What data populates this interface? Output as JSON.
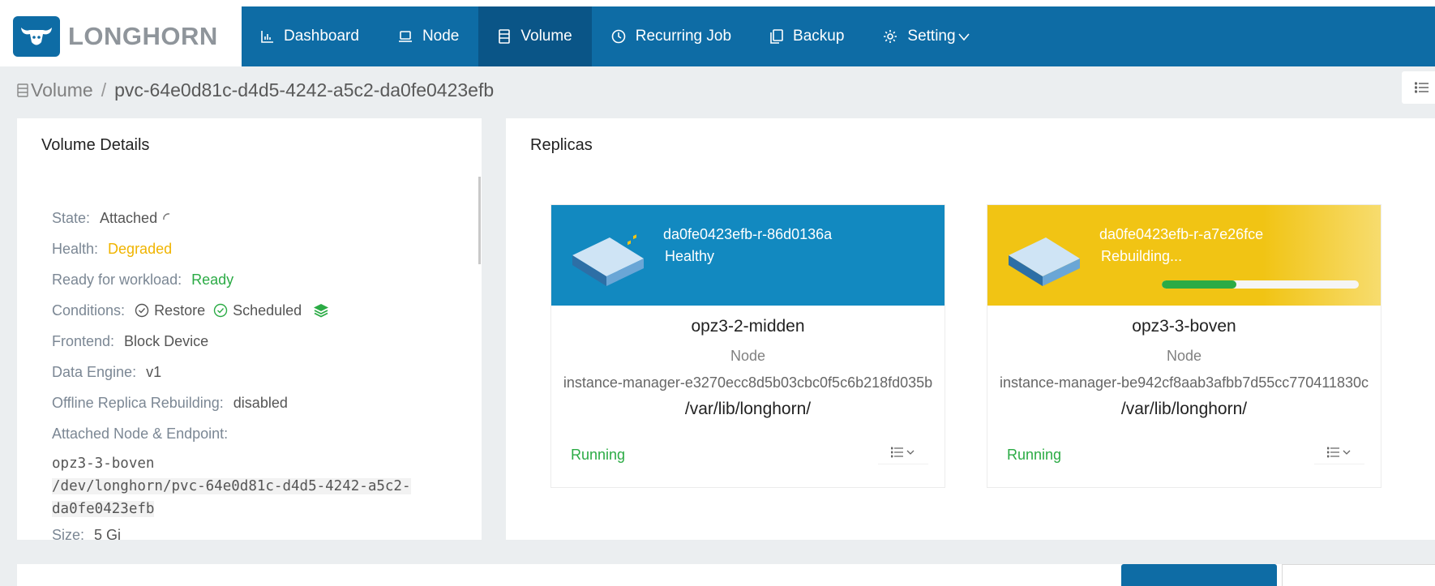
{
  "brand": {
    "name": "LONGHORN"
  },
  "nav": {
    "items": [
      {
        "label": "Dashboard",
        "icon": "bar-chart-icon"
      },
      {
        "label": "Node",
        "icon": "laptop-icon"
      },
      {
        "label": "Volume",
        "icon": "database-icon",
        "active": true
      },
      {
        "label": "Recurring Job",
        "icon": "clock-icon"
      },
      {
        "label": "Backup",
        "icon": "copy-icon"
      },
      {
        "label": "Setting",
        "icon": "gear-icon"
      }
    ]
  },
  "breadcrumb": {
    "parent": "Volume",
    "separator": "/",
    "current": "pvc-64e0d81c-d4d5-4242-a5c2-da0fe0423efb"
  },
  "details": {
    "title": "Volume Details",
    "state_label": "State:",
    "state_value": "Attached",
    "health_label": "Health:",
    "health_value": "Degraded",
    "ready_label": "Ready for workload:",
    "ready_value": "Ready",
    "conditions_label": "Conditions:",
    "condition_restore": "Restore",
    "condition_scheduled": "Scheduled",
    "frontend_label": "Frontend:",
    "frontend_value": "Block Device",
    "engine_label": "Data Engine:",
    "engine_value": "v1",
    "offline_label": "Offline Replica Rebuilding:",
    "offline_value": "disabled",
    "attached_label": "Attached Node & Endpoint:",
    "attached_node": "opz3-3-boven",
    "endpoint_line1": "/dev/longhorn/pvc-64e0d81c-d4d5-4242-a5c2-",
    "endpoint_line2": "da0fe0423efb",
    "size_label": "Size:",
    "size_value": "5 Gi"
  },
  "replicas": {
    "title": "Replicas",
    "items": [
      {
        "name": "da0fe0423efb-r-86d0136a",
        "state": "Healthy",
        "node": "opz3-2-midden",
        "node_label": "Node",
        "instance_manager": "instance-manager-e3270ecc8d5b03cbc0f5c6b218fd035b",
        "path": "/var/lib/longhorn/",
        "status": "Running",
        "color": "#1289c0"
      },
      {
        "name": "da0fe0423efb-r-a7e26fce",
        "state": "Rebuilding...",
        "rebuild_progress": 0.38,
        "node": "opz3-3-boven",
        "node_label": "Node",
        "instance_manager": "instance-manager-be942cf8aab3afbb7d55cc770411830c",
        "path": "/var/lib/longhorn/",
        "status": "Running",
        "color": "#f1c414"
      }
    ]
  },
  "colors": {
    "brand": "#0e6ca5",
    "nav_active": "#0a5587",
    "healthy": "#2bab45",
    "degraded": "#f0b400"
  }
}
